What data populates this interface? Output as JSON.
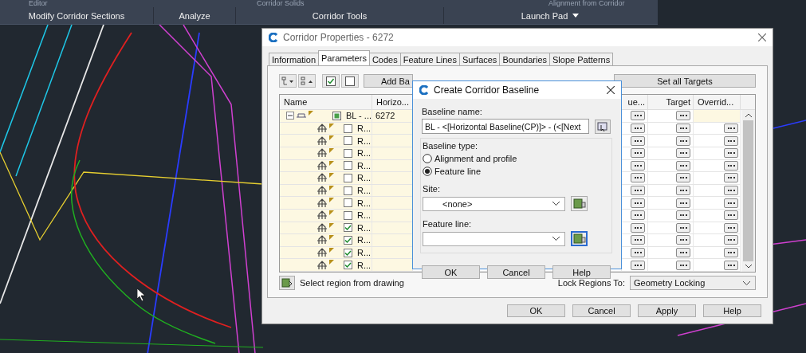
{
  "ribbon": {
    "faded_labels": [
      "Editor",
      "Corridor Solids",
      "Alignment from Corridor"
    ],
    "panels": [
      {
        "label": "Modify Corridor Sections",
        "dropdown": false
      },
      {
        "label": "Analyze",
        "dropdown": false
      },
      {
        "label": "Corridor Tools",
        "dropdown": false
      },
      {
        "label": "Launch Pad",
        "dropdown": true
      }
    ]
  },
  "corridor_properties": {
    "title": "Corridor Properties - 6272",
    "tabs": [
      {
        "label": "Information",
        "selected": false
      },
      {
        "label": "Parameters",
        "selected": true
      },
      {
        "label": "Codes",
        "selected": false
      },
      {
        "label": "Feature Lines",
        "selected": false
      },
      {
        "label": "Surfaces",
        "selected": false
      },
      {
        "label": "Boundaries",
        "selected": false
      },
      {
        "label": "Slope Patterns",
        "selected": false
      }
    ],
    "toolbar_buttons": [
      "Add Ba",
      "Set all Targets"
    ],
    "grid": {
      "columns": [
        "Name",
        "Horizo...",
        "ue...",
        "Target",
        "Overrid..."
      ],
      "baseline": {
        "name": "BL - ...",
        "horizontal": "6272",
        "partial": true,
        "expanded": true
      },
      "regions": [
        {
          "name": "R...",
          "checked": false
        },
        {
          "name": "R...",
          "checked": false
        },
        {
          "name": "R...",
          "checked": false
        },
        {
          "name": "R...",
          "checked": false
        },
        {
          "name": "R...",
          "checked": false
        },
        {
          "name": "R...",
          "checked": false
        },
        {
          "name": "R...",
          "checked": false
        },
        {
          "name": "R...",
          "checked": false
        },
        {
          "name": "R...",
          "checked": true
        },
        {
          "name": "R...",
          "checked": true
        },
        {
          "name": "R...",
          "checked": true
        },
        {
          "name": "R...",
          "checked": true
        }
      ]
    },
    "select_region": "Select region from drawing",
    "lock_label": "Lock Regions To:",
    "lock_value": "Geometry Locking",
    "buttons": [
      "OK",
      "Cancel",
      "Apply",
      "Help"
    ]
  },
  "create_baseline": {
    "title": "Create Corridor Baseline",
    "name_label": "Baseline name:",
    "name_value": "BL - <[Horizontal Baseline(CP)]> - (<[Next",
    "type_label": "Baseline type:",
    "types": [
      {
        "label": "Alignment and profile",
        "selected": false
      },
      {
        "label": "Feature line",
        "selected": true
      }
    ],
    "site_label": "Site:",
    "site_value": "<none>",
    "feature_label": "Feature line:",
    "feature_pick_focused": true,
    "buttons": [
      "OK",
      "Cancel",
      "Help"
    ]
  }
}
